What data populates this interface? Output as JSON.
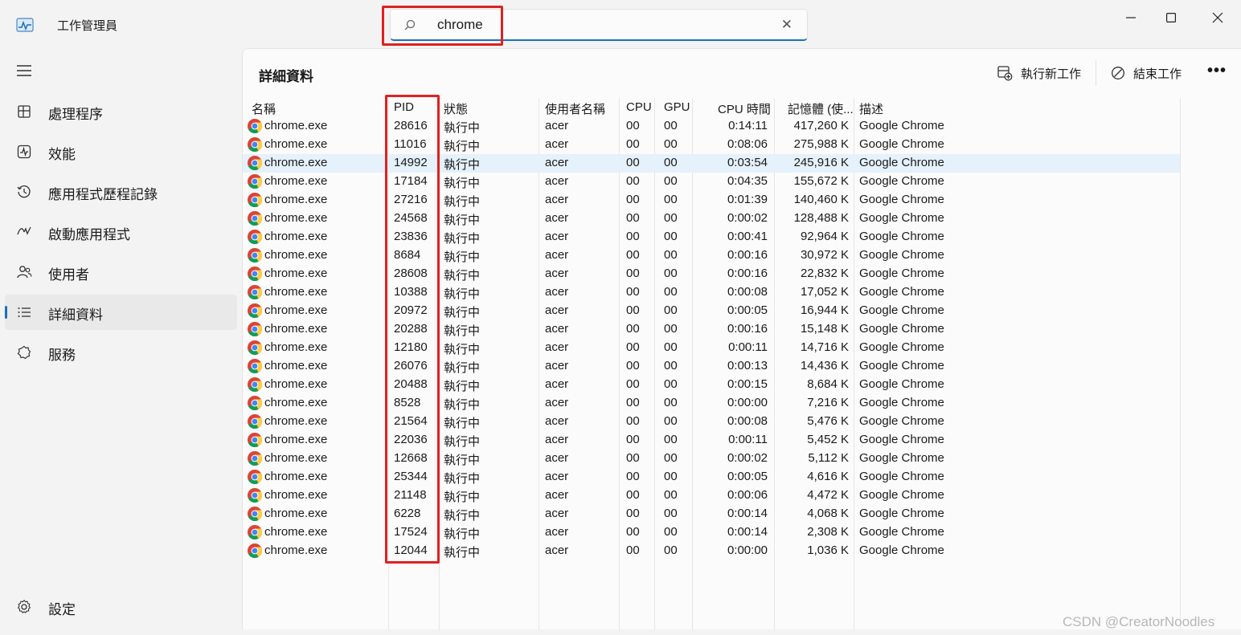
{
  "app": {
    "title": "工作管理員"
  },
  "search": {
    "value": "chrome"
  },
  "sidebar": {
    "items": [
      {
        "label": "處理程序",
        "icon": "processes-icon"
      },
      {
        "label": "效能",
        "icon": "performance-icon"
      },
      {
        "label": "應用程式歷程記錄",
        "icon": "history-icon"
      },
      {
        "label": "啟動應用程式",
        "icon": "startup-icon"
      },
      {
        "label": "使用者",
        "icon": "users-icon"
      },
      {
        "label": "詳細資料",
        "icon": "details-icon",
        "active": true
      },
      {
        "label": "服務",
        "icon": "services-icon"
      }
    ],
    "settings_label": "設定"
  },
  "main": {
    "title": "詳細資料",
    "toolbar": {
      "run_label": "執行新工作",
      "end_label": "結束工作"
    },
    "columns": [
      "名稱",
      "PID",
      "狀態",
      "使用者名稱",
      "CPU",
      "GPU",
      "CPU 時間",
      "記憶體 (使...",
      "描述"
    ],
    "rows": [
      {
        "name": "chrome.exe",
        "pid": "28616",
        "status": "執行中",
        "user": "acer",
        "cpu": "00",
        "gpu": "00",
        "cpu_time": "0:14:11",
        "memory": "417,260 K",
        "desc": "Google Chrome"
      },
      {
        "name": "chrome.exe",
        "pid": "11016",
        "status": "執行中",
        "user": "acer",
        "cpu": "00",
        "gpu": "00",
        "cpu_time": "0:08:06",
        "memory": "275,988 K",
        "desc": "Google Chrome"
      },
      {
        "name": "chrome.exe",
        "pid": "14992",
        "status": "執行中",
        "user": "acer",
        "cpu": "00",
        "gpu": "00",
        "cpu_time": "0:03:54",
        "memory": "245,916 K",
        "desc": "Google Chrome",
        "selected": true
      },
      {
        "name": "chrome.exe",
        "pid": "17184",
        "status": "執行中",
        "user": "acer",
        "cpu": "00",
        "gpu": "00",
        "cpu_time": "0:04:35",
        "memory": "155,672 K",
        "desc": "Google Chrome"
      },
      {
        "name": "chrome.exe",
        "pid": "27216",
        "status": "執行中",
        "user": "acer",
        "cpu": "00",
        "gpu": "00",
        "cpu_time": "0:01:39",
        "memory": "140,460 K",
        "desc": "Google Chrome"
      },
      {
        "name": "chrome.exe",
        "pid": "24568",
        "status": "執行中",
        "user": "acer",
        "cpu": "00",
        "gpu": "00",
        "cpu_time": "0:00:02",
        "memory": "128,488 K",
        "desc": "Google Chrome"
      },
      {
        "name": "chrome.exe",
        "pid": "23836",
        "status": "執行中",
        "user": "acer",
        "cpu": "00",
        "gpu": "00",
        "cpu_time": "0:00:41",
        "memory": "92,964 K",
        "desc": "Google Chrome"
      },
      {
        "name": "chrome.exe",
        "pid": "8684",
        "status": "執行中",
        "user": "acer",
        "cpu": "00",
        "gpu": "00",
        "cpu_time": "0:00:16",
        "memory": "30,972 K",
        "desc": "Google Chrome"
      },
      {
        "name": "chrome.exe",
        "pid": "28608",
        "status": "執行中",
        "user": "acer",
        "cpu": "00",
        "gpu": "00",
        "cpu_time": "0:00:16",
        "memory": "22,832 K",
        "desc": "Google Chrome"
      },
      {
        "name": "chrome.exe",
        "pid": "10388",
        "status": "執行中",
        "user": "acer",
        "cpu": "00",
        "gpu": "00",
        "cpu_time": "0:00:08",
        "memory": "17,052 K",
        "desc": "Google Chrome"
      },
      {
        "name": "chrome.exe",
        "pid": "20972",
        "status": "執行中",
        "user": "acer",
        "cpu": "00",
        "gpu": "00",
        "cpu_time": "0:00:05",
        "memory": "16,944 K",
        "desc": "Google Chrome"
      },
      {
        "name": "chrome.exe",
        "pid": "20288",
        "status": "執行中",
        "user": "acer",
        "cpu": "00",
        "gpu": "00",
        "cpu_time": "0:00:16",
        "memory": "15,148 K",
        "desc": "Google Chrome"
      },
      {
        "name": "chrome.exe",
        "pid": "12180",
        "status": "執行中",
        "user": "acer",
        "cpu": "00",
        "gpu": "00",
        "cpu_time": "0:00:11",
        "memory": "14,716 K",
        "desc": "Google Chrome"
      },
      {
        "name": "chrome.exe",
        "pid": "26076",
        "status": "執行中",
        "user": "acer",
        "cpu": "00",
        "gpu": "00",
        "cpu_time": "0:00:13",
        "memory": "14,436 K",
        "desc": "Google Chrome"
      },
      {
        "name": "chrome.exe",
        "pid": "20488",
        "status": "執行中",
        "user": "acer",
        "cpu": "00",
        "gpu": "00",
        "cpu_time": "0:00:15",
        "memory": "8,684 K",
        "desc": "Google Chrome"
      },
      {
        "name": "chrome.exe",
        "pid": "8528",
        "status": "執行中",
        "user": "acer",
        "cpu": "00",
        "gpu": "00",
        "cpu_time": "0:00:00",
        "memory": "7,216 K",
        "desc": "Google Chrome"
      },
      {
        "name": "chrome.exe",
        "pid": "21564",
        "status": "執行中",
        "user": "acer",
        "cpu": "00",
        "gpu": "00",
        "cpu_time": "0:00:08",
        "memory": "5,476 K",
        "desc": "Google Chrome"
      },
      {
        "name": "chrome.exe",
        "pid": "22036",
        "status": "執行中",
        "user": "acer",
        "cpu": "00",
        "gpu": "00",
        "cpu_time": "0:00:11",
        "memory": "5,452 K",
        "desc": "Google Chrome"
      },
      {
        "name": "chrome.exe",
        "pid": "12668",
        "status": "執行中",
        "user": "acer",
        "cpu": "00",
        "gpu": "00",
        "cpu_time": "0:00:02",
        "memory": "5,112 K",
        "desc": "Google Chrome"
      },
      {
        "name": "chrome.exe",
        "pid": "25344",
        "status": "執行中",
        "user": "acer",
        "cpu": "00",
        "gpu": "00",
        "cpu_time": "0:00:05",
        "memory": "4,616 K",
        "desc": "Google Chrome"
      },
      {
        "name": "chrome.exe",
        "pid": "21148",
        "status": "執行中",
        "user": "acer",
        "cpu": "00",
        "gpu": "00",
        "cpu_time": "0:00:06",
        "memory": "4,472 K",
        "desc": "Google Chrome"
      },
      {
        "name": "chrome.exe",
        "pid": "6228",
        "status": "執行中",
        "user": "acer",
        "cpu": "00",
        "gpu": "00",
        "cpu_time": "0:00:14",
        "memory": "4,068 K",
        "desc": "Google Chrome"
      },
      {
        "name": "chrome.exe",
        "pid": "17524",
        "status": "執行中",
        "user": "acer",
        "cpu": "00",
        "gpu": "00",
        "cpu_time": "0:00:14",
        "memory": "2,308 K",
        "desc": "Google Chrome"
      },
      {
        "name": "chrome.exe",
        "pid": "12044",
        "status": "執行中",
        "user": "acer",
        "cpu": "00",
        "gpu": "00",
        "cpu_time": "0:00:00",
        "memory": "1,036 K",
        "desc": "Google Chrome"
      }
    ]
  },
  "watermark": "CSDN @CreatorNoodles",
  "colors": {
    "accent": "#1a6fc0",
    "highlight_box": "#e02020",
    "selected_row": "#e5f1fb"
  }
}
